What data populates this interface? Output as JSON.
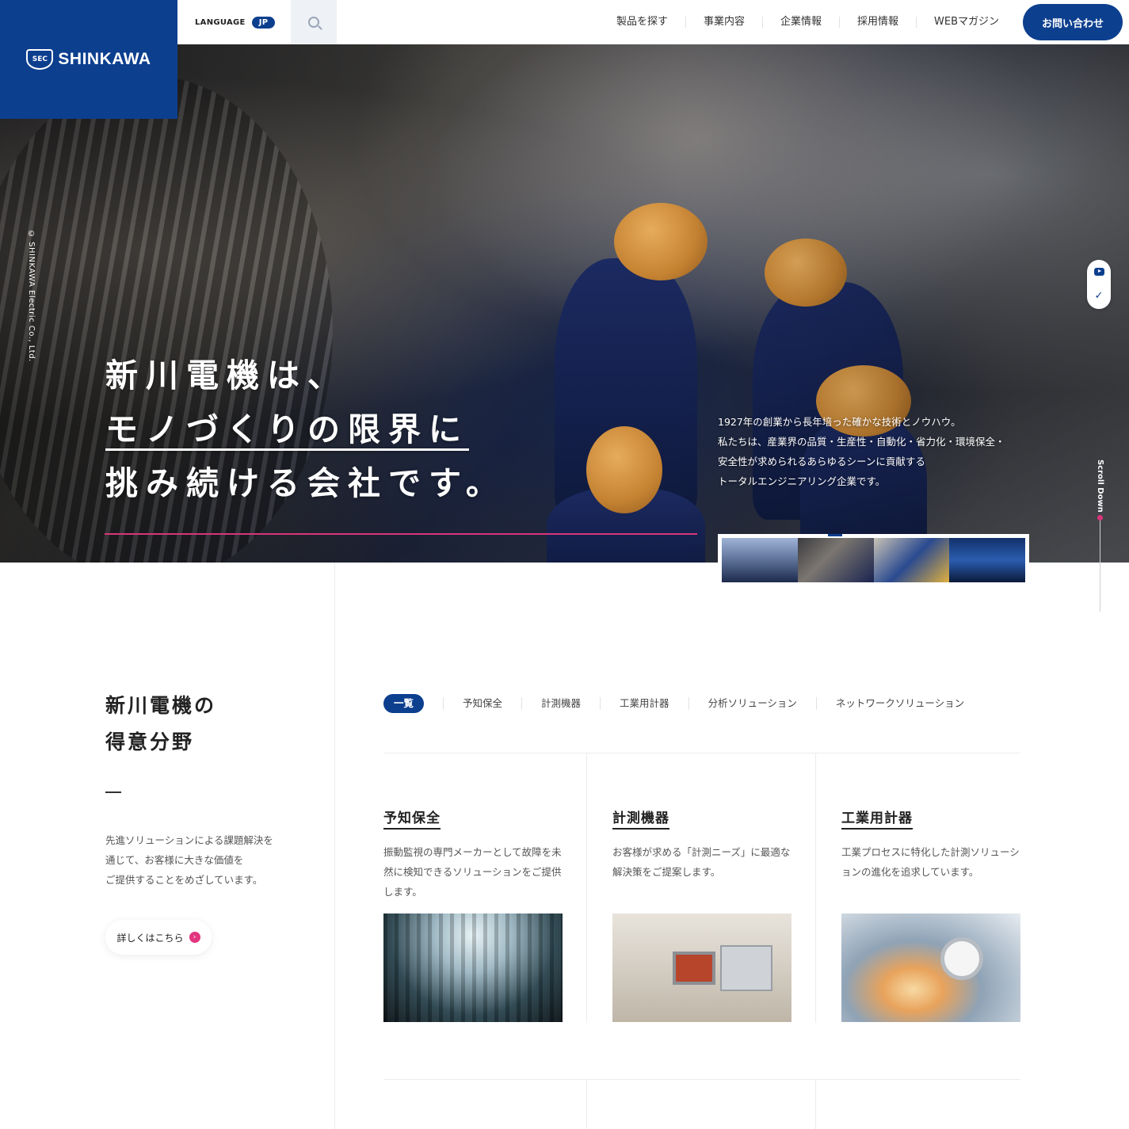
{
  "header": {
    "logo_text": "SHINKAWA",
    "logo_emblem": "SEC",
    "language_label": "LANGUAGE",
    "language_value": "JP",
    "nav": [
      "製品を探す",
      "事業内容",
      "企業情報",
      "採用情報",
      "WEBマガジン"
    ],
    "contact_label": "お問い合わせ"
  },
  "hero": {
    "copyright": "© SHINKAWA Electric Co., Ltd.",
    "headline_1": "新川電機は、",
    "headline_2": "モノづくりの限界に",
    "headline_3": "挑み続ける会社です。",
    "desc_1": "1927年の創業から長年培った確かな技術とノウハウ。",
    "desc_2": "私たちは、産業界の品質・生産性・自動化・省力化・環境保全・",
    "desc_3": "安全性が求められるあらゆるシーンに貢献する",
    "desc_4": "トータルエンジニアリング企業です。",
    "scroll_label": "Scroll Down",
    "social": [
      "youtube-icon",
      "twitter-icon"
    ]
  },
  "strengths": {
    "title_1": "新川電機の",
    "title_2": "得意分野",
    "text_1": "先進ソリューションによる課題解決を",
    "text_2": "通じて、お客様に大きな価値を",
    "text_3": "ご提供することをめざしています。",
    "more_label": "詳しくはこちら",
    "tabs": [
      "一覧",
      "予知保全",
      "計測機器",
      "工業用計器",
      "分析ソリューション",
      "ネットワークソリューション"
    ],
    "active_tab": "一覧",
    "cards": [
      {
        "title": "予知保全",
        "text": "振動監視の専門メーカーとして故障を未然に検知できるソリューションをご提供します。"
      },
      {
        "title": "計測機器",
        "text": "お客様が求める「計測ニーズ」に最適な解決策をご提案します。"
      },
      {
        "title": "工業用計器",
        "text": "工業プロセスに特化した計測ソリューションの進化を追求しています。"
      }
    ]
  },
  "colors": {
    "brand": "#0d3f8f",
    "accent": "#d8357a"
  }
}
